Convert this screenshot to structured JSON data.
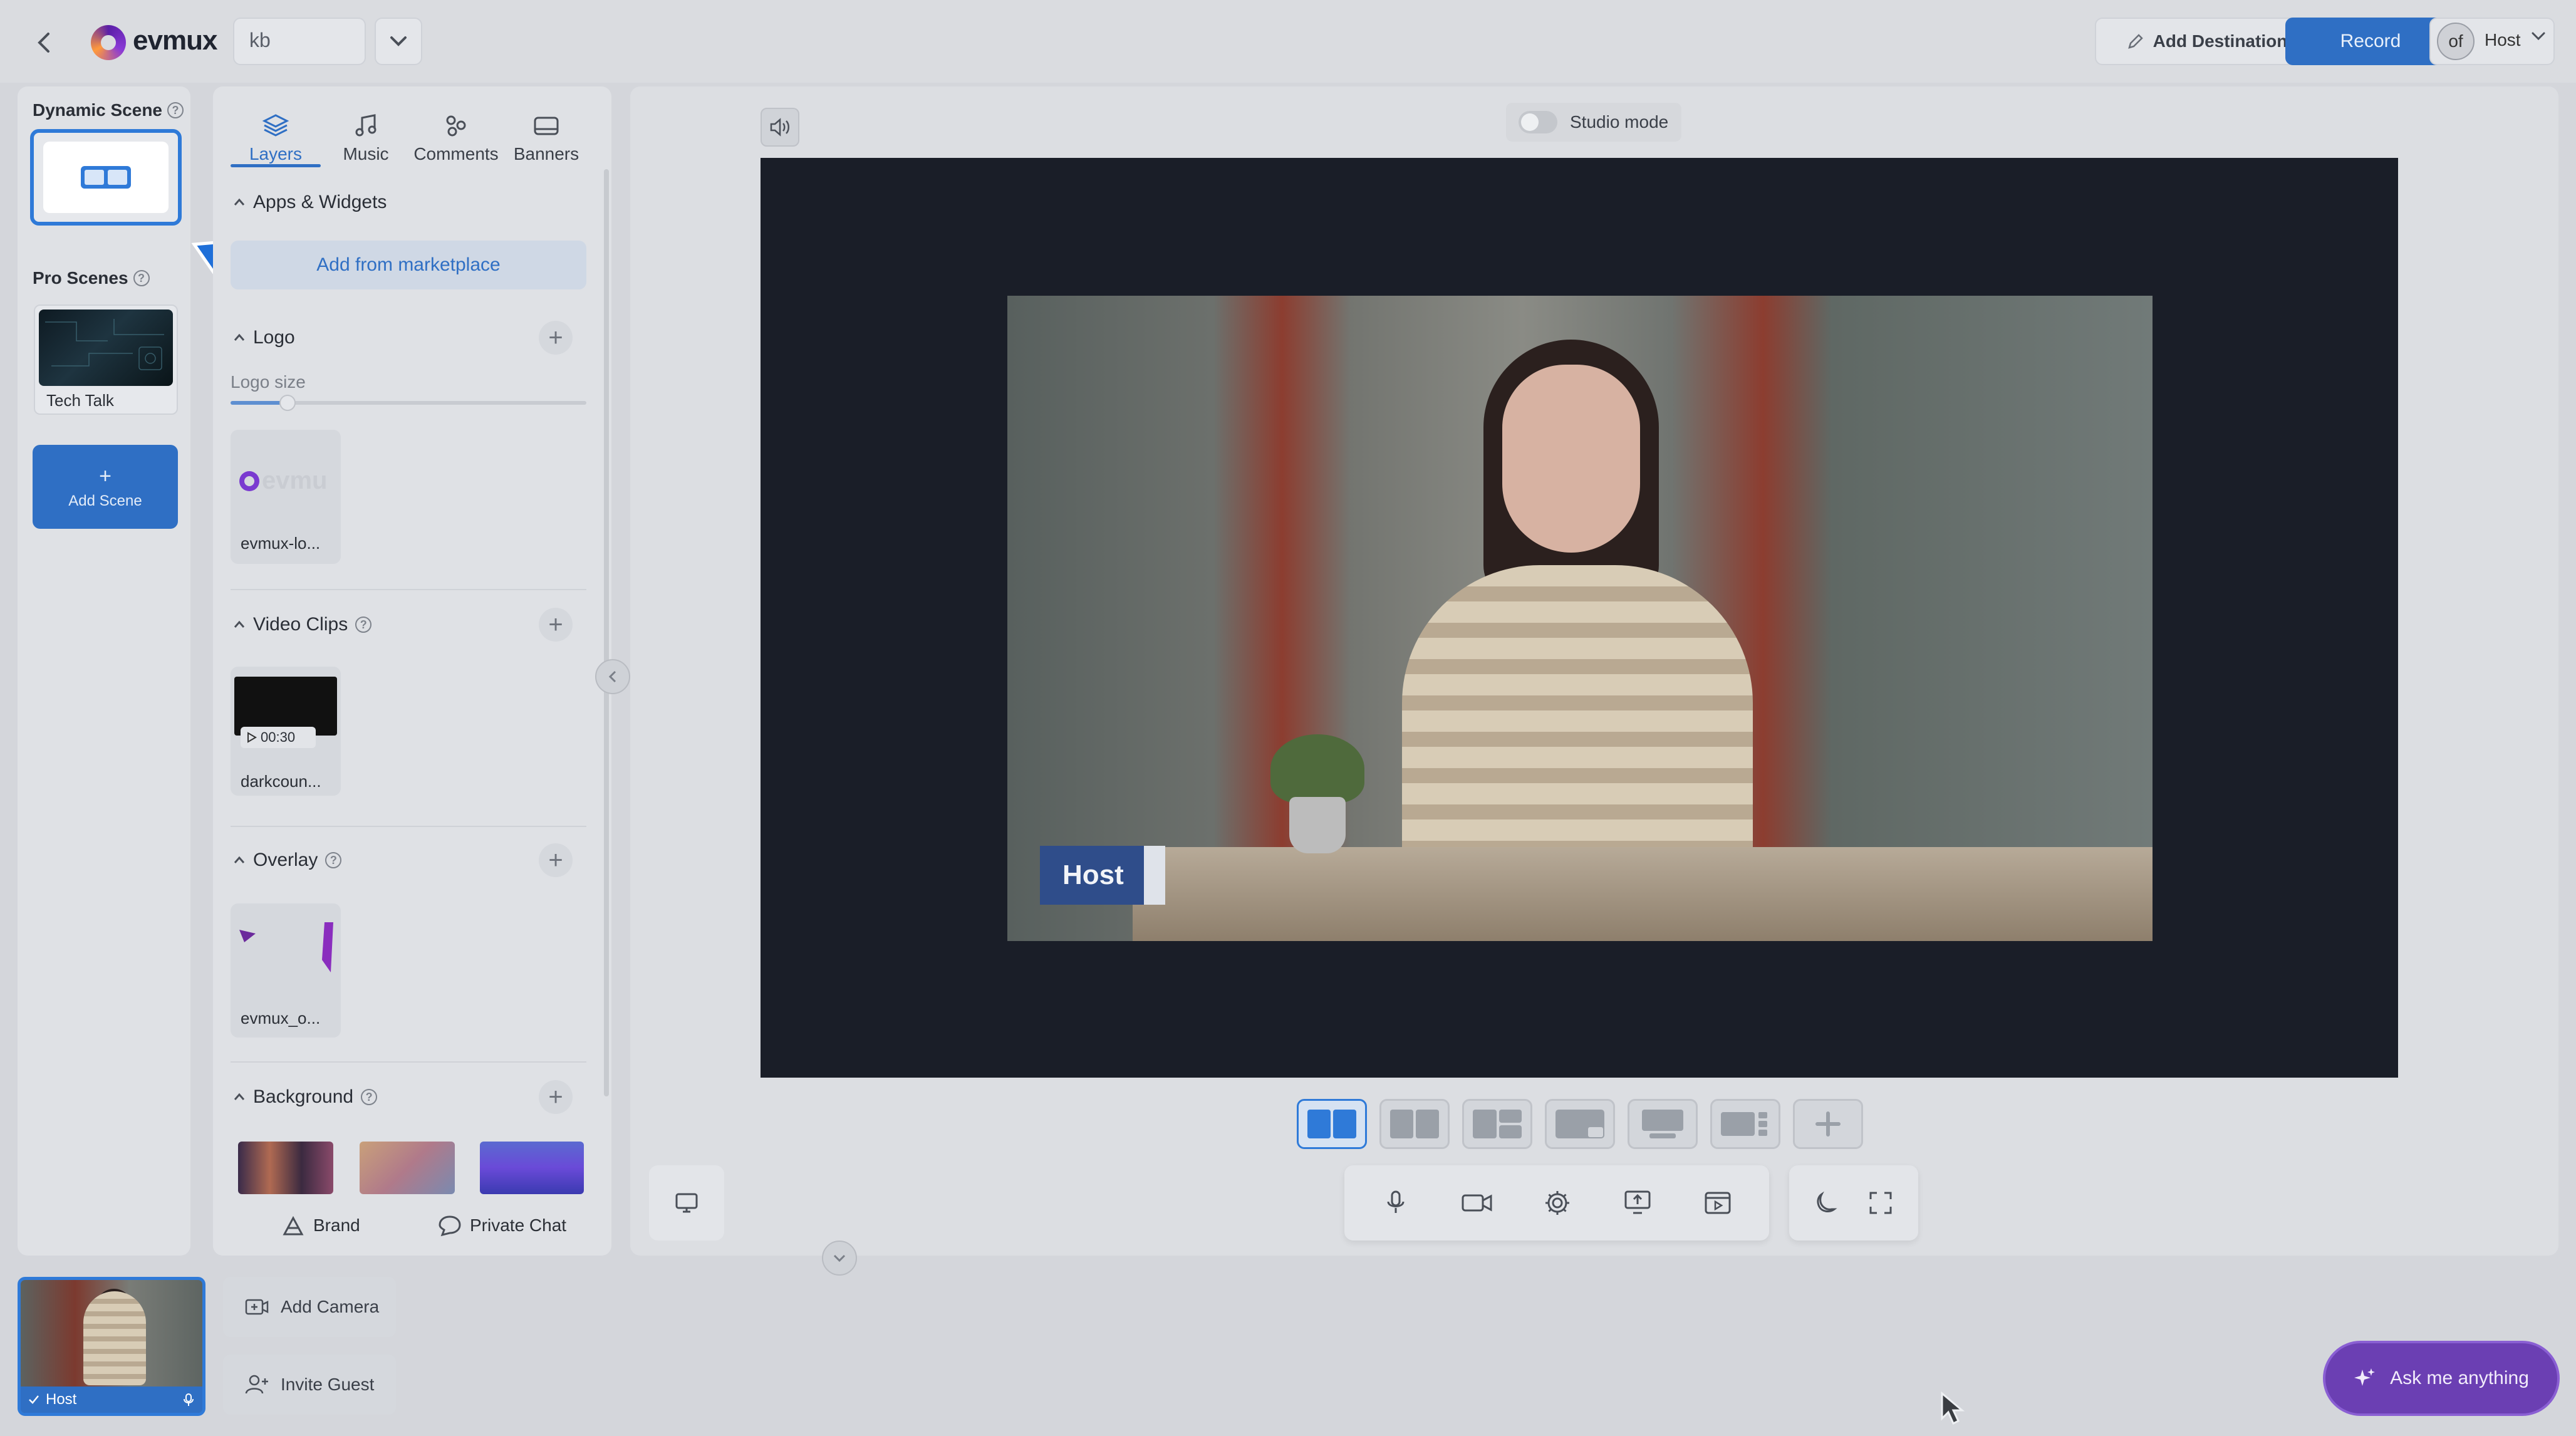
{
  "header": {
    "brand": "evmux",
    "project_value": "kb",
    "add_destination": "Add Destination",
    "record": "Record",
    "host_avatar_text": "of",
    "host_label": "Host"
  },
  "scenes": {
    "dynamic_title": "Dynamic Scene",
    "pro_title": "Pro Scenes",
    "pro_items": [
      {
        "label": "Tech Talk"
      }
    ],
    "add_scene_plus": "+",
    "add_scene": "Add Scene"
  },
  "panel": {
    "tabs": [
      {
        "label": "Layers",
        "icon": "layers-icon"
      },
      {
        "label": "Music",
        "icon": "music-note-icon"
      },
      {
        "label": "Comments",
        "icon": "comments-icon"
      },
      {
        "label": "Banners",
        "icon": "banner-icon"
      }
    ],
    "apps_title": "Apps & Widgets",
    "marketplace": "Add from marketplace",
    "logo_title": "Logo",
    "logo_size_label": "Logo size",
    "logo_size_fraction": 0.16,
    "logo_asset": "evmux-lo...",
    "video_clips_title": "Video Clips",
    "video_asset": "darkcoun...",
    "video_duration": "00:30",
    "overlay_title": "Overlay",
    "overlay_asset": "evmux_o...",
    "background_title": "Background",
    "footer_brand": "Brand",
    "footer_chat": "Private Chat"
  },
  "stage": {
    "studio_mode": "Studio mode",
    "name_tag": "Host"
  },
  "bottom": {
    "host_tile_label": "Host",
    "add_camera": "Add Camera",
    "invite_guest": "Invite Guest",
    "ask": "Ask me anything"
  },
  "colors": {
    "accent": "#2f6fc4",
    "ask_purple": "#6b3fb3",
    "canvas_bg": "#1a1e28"
  }
}
